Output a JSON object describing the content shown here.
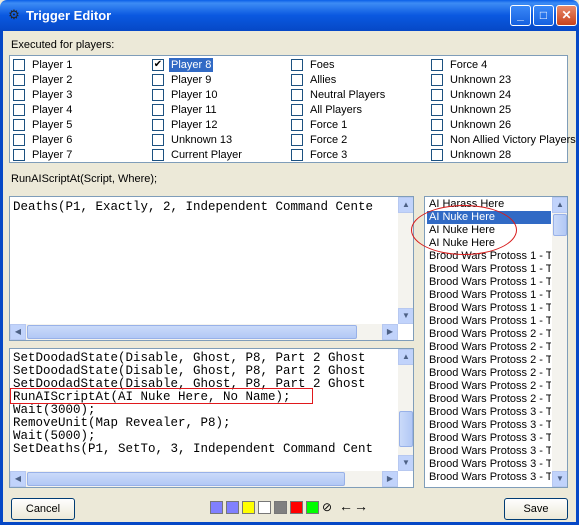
{
  "window": {
    "title": "Trigger Editor",
    "title_icon": "gear-icon",
    "controls": [
      "minimize-icon",
      "maximize-icon",
      "close-icon"
    ]
  },
  "players": {
    "label": "Executed for players:",
    "items": [
      {
        "label": "Player 1",
        "checked": false
      },
      {
        "label": "Player 2",
        "checked": false
      },
      {
        "label": "Player 3",
        "checked": false
      },
      {
        "label": "Player 4",
        "checked": false
      },
      {
        "label": "Player 5",
        "checked": false
      },
      {
        "label": "Player 6",
        "checked": false
      },
      {
        "label": "Player 7",
        "checked": false
      },
      {
        "label": "Player 8",
        "checked": true,
        "selected": true
      },
      {
        "label": "Player 9",
        "checked": false
      },
      {
        "label": "Player 10",
        "checked": false
      },
      {
        "label": "Player 11",
        "checked": false
      },
      {
        "label": "Player 12",
        "checked": false
      },
      {
        "label": "Unknown 13",
        "checked": false
      },
      {
        "label": "Current Player",
        "checked": false
      },
      {
        "label": "Foes",
        "checked": false
      },
      {
        "label": "Allies",
        "checked": false
      },
      {
        "label": "Neutral Players",
        "checked": false
      },
      {
        "label": "All Players",
        "checked": false
      },
      {
        "label": "Force 1",
        "checked": false
      },
      {
        "label": "Force 2",
        "checked": false
      },
      {
        "label": "Force 3",
        "checked": false
      },
      {
        "label": "Force 4",
        "checked": false
      },
      {
        "label": "Unknown 23",
        "checked": false
      },
      {
        "label": "Unknown 24",
        "checked": false
      },
      {
        "label": "Unknown 25",
        "checked": false
      },
      {
        "label": "Unknown 26",
        "checked": false
      },
      {
        "label": "Non Allied Victory Players",
        "checked": false
      },
      {
        "label": "Unknown 28",
        "checked": false
      }
    ]
  },
  "action": {
    "signature": "RunAIScriptAt(Script, Where);"
  },
  "conditions": {
    "lines": [
      "Deaths(P1, Exactly, 2, Independent Command Cente"
    ]
  },
  "actions": {
    "lines": [
      "SetDoodadState(Disable, Ghost, P8, Part 2 Ghost",
      "SetDoodadState(Disable, Ghost, P8, Part 2 Ghost",
      "SetDoodadState(Disable, Ghost, P8, Part 2 Ghost",
      "RunAIScriptAt(AI Nuke Here, No Name);",
      "Wait(3000);",
      "RemoveUnit(Map Revealer, P8);",
      "Wait(5000);",
      "SetDeaths(P1, SetTo, 3, Independent Command Cent"
    ],
    "highlighted_index": 3
  },
  "scripts": {
    "items": [
      "AI Harass Here",
      "AI Nuke Here",
      "AI Nuke Here",
      "AI Nuke Here",
      "Brood Wars Protoss 1 - To",
      "Brood Wars Protoss 1 - To",
      "Brood Wars Protoss 1 - To",
      "Brood Wars Protoss 1 - To",
      "Brood Wars Protoss 1 - To",
      "Brood Wars Protoss 1 - To",
      "Brood Wars Protoss 2 - To",
      "Brood Wars Protoss 2 - To",
      "Brood Wars Protoss 2 - To",
      "Brood Wars Protoss 2 - To",
      "Brood Wars Protoss 2 - To",
      "Brood Wars Protoss 2 - To",
      "Brood Wars Protoss 3 - To",
      "Brood Wars Protoss 3 - To",
      "Brood Wars Protoss 3 - To",
      "Brood Wars Protoss 3 - To",
      "Brood Wars Protoss 3 - To",
      "Brood Wars Protoss 3 - To"
    ],
    "selected_index": 1
  },
  "buttons": {
    "cancel": "Cancel",
    "save": "Save"
  },
  "palette": {
    "colors": [
      "#8080ff",
      "#8080ff",
      "#ffff00",
      "#ffffff",
      "#808080",
      "#ff0000",
      "#00ff00"
    ],
    "tools": [
      "no-color-icon",
      "arrow-left-icon",
      "arrow-right-icon"
    ]
  },
  "annotations": {
    "color": "#e0181c"
  }
}
